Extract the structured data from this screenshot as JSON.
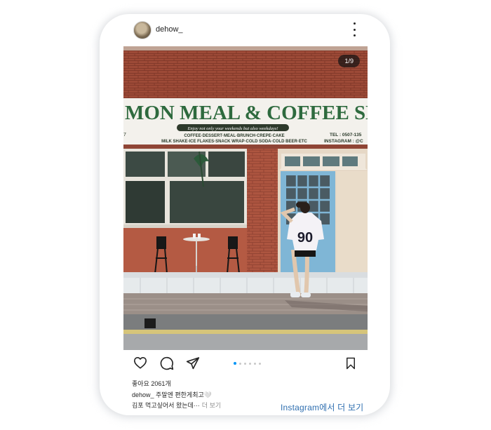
{
  "post": {
    "username": "dehow_",
    "image_counter": "1/9",
    "likes": "좋아요 2061개",
    "caption_line1": "dehow_ 주말엔 편한게최고🤍",
    "caption_line2": "김포 먹고싶어서 왔는데···",
    "more_label": "더 보기",
    "view_on_instagram": "Instagram에서 더 보기",
    "carousel_total": 6,
    "carousel_active": 1
  },
  "photo": {
    "sign_text": "MON MEAL & COFFEE SHOP",
    "sign_tagline": "Enjoy not only your weekends but also weekdays!",
    "sign_menu1": "COFFEE·DESSERT·MEAL·BRUNCH·CREPE·CAKE",
    "sign_menu2": "MILK SHAKE·ICE FLAKES·SNACK WRAP·COLD SODA·COLD BEER·ETC",
    "sign_tel": "TEL : 0507-135",
    "sign_insta": "INSTAGRAM : @C",
    "sign_left_digit": "7",
    "shirt_number": "90"
  },
  "icons": {
    "heart": "heart-icon",
    "comment": "comment-icon",
    "share": "share-icon",
    "save": "bookmark-icon",
    "more": "more-vertical-icon"
  },
  "colors": {
    "sign_green": "#2e6a3e",
    "door_blue": "#7fb6d6",
    "link_blue": "#2f6fb0",
    "active_dot": "#0095f6"
  }
}
